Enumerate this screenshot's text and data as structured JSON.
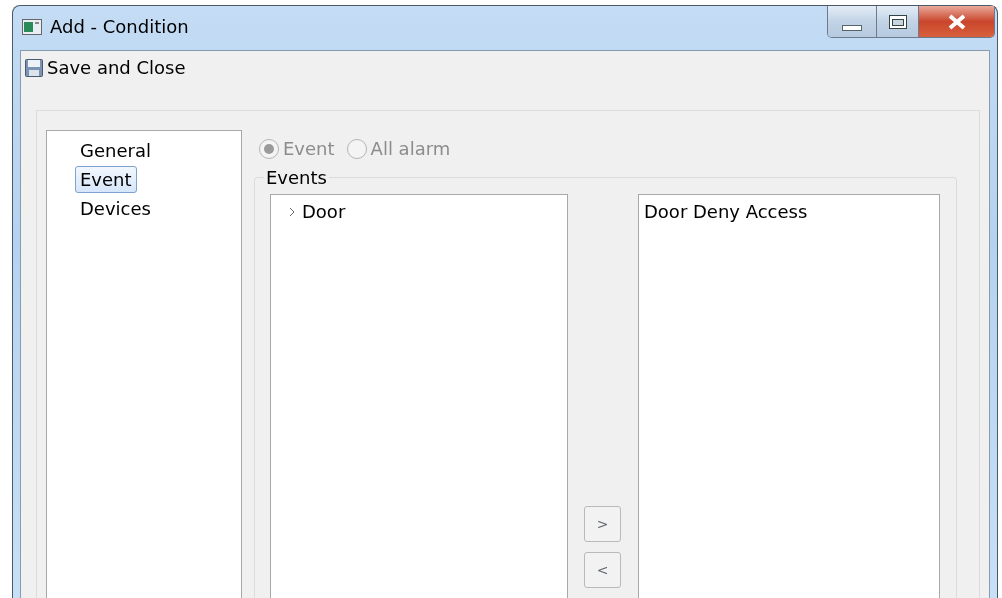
{
  "window": {
    "title": "Add - Condition"
  },
  "toolbar": {
    "save_button": "Save and Close"
  },
  "sidebar": {
    "items": [
      {
        "label": "General",
        "selected": false
      },
      {
        "label": "Event",
        "selected": true
      },
      {
        "label": "Devices",
        "selected": false
      }
    ]
  },
  "mode_options": [
    {
      "label": "Event",
      "selected": true,
      "disabled": true
    },
    {
      "label": "All alarm",
      "selected": false,
      "disabled": true
    }
  ],
  "events_group": {
    "title": "Events",
    "available_tree": [
      {
        "label": "Door",
        "expanded": false
      }
    ],
    "move_buttons": [
      ">",
      "<"
    ],
    "selected_list": [
      "Door Deny Access"
    ]
  }
}
